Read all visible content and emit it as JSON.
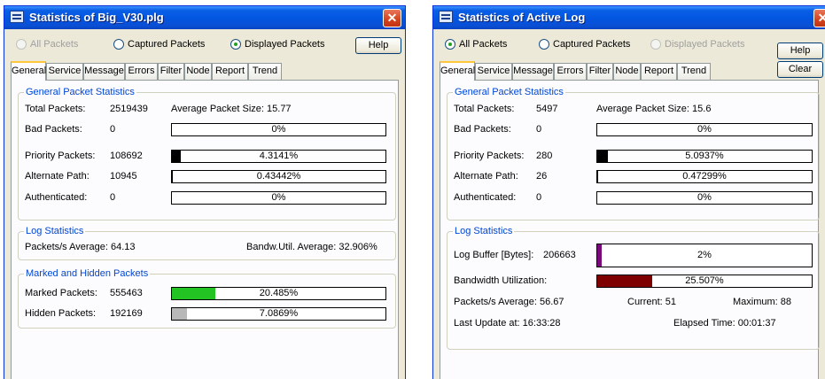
{
  "left_window": {
    "title": "Statistics of Big_V30.plg",
    "radios": [
      {
        "label": "All Packets",
        "checked": false,
        "disabled": true
      },
      {
        "label": "Captured Packets",
        "checked": false,
        "disabled": false
      },
      {
        "label": "Displayed Packets",
        "checked": true,
        "disabled": false
      }
    ],
    "help_label": "Help",
    "tabs": [
      "General",
      "Service",
      "Message",
      "Errors",
      "Filter",
      "Node",
      "Report",
      "Trend"
    ],
    "active_tab": "General",
    "general": {
      "title": "General Packet Statistics",
      "total_label": "Total Packets:",
      "total_value": "2519439",
      "avg_size": "Average Packet Size:  15.77",
      "bad_label": "Bad Packets:",
      "bad_value": "0",
      "bad_pct": "0%",
      "bad_frac": 0,
      "priority_label": "Priority Packets:",
      "priority_value": "108692",
      "priority_pct": "4.3141%",
      "priority_frac": 0.043,
      "alternate_label": "Alternate Path:",
      "alternate_value": "10945",
      "alternate_pct": "0.43442%",
      "alternate_frac": 0.004,
      "auth_label": "Authenticated:",
      "auth_value": "0",
      "auth_pct": "0%",
      "auth_frac": 0
    },
    "log": {
      "title": "Log Statistics",
      "pps": "Packets/s Average:  64.13",
      "bandw": "Bandw.Util. Average:   32.906%"
    },
    "marked": {
      "title": "Marked and Hidden Packets",
      "marked_label": "Marked Packets:",
      "marked_value": "555463",
      "marked_pct": "20.485%",
      "marked_frac": 0.205,
      "hidden_label": "Hidden Packets:",
      "hidden_value": "192169",
      "hidden_pct": "7.0869%",
      "hidden_frac": 0.071
    }
  },
  "right_window": {
    "title": "Statistics of Active Log",
    "radios": [
      {
        "label": "All Packets",
        "checked": true,
        "disabled": false
      },
      {
        "label": "Captured Packets",
        "checked": false,
        "disabled": false
      },
      {
        "label": "Displayed Packets",
        "checked": false,
        "disabled": true
      }
    ],
    "help_label": "Help",
    "clear_label": "Clear",
    "tabs": [
      "General",
      "Service",
      "Message",
      "Errors",
      "Filter",
      "Node",
      "Report",
      "Trend"
    ],
    "active_tab": "General",
    "general": {
      "title": "General Packet Statistics",
      "total_label": "Total Packets:",
      "total_value": "5497",
      "avg_size": "Average Packet Size:  15.6",
      "bad_label": "Bad Packets:",
      "bad_value": "0",
      "bad_pct": "0%",
      "bad_frac": 0,
      "priority_label": "Priority Packets:",
      "priority_value": "280",
      "priority_pct": "5.0937%",
      "priority_frac": 0.051,
      "alternate_label": "Alternate Path:",
      "alternate_value": "26",
      "alternate_pct": "0.47299%",
      "alternate_frac": 0.005,
      "auth_label": "Authenticated:",
      "auth_value": "0",
      "auth_pct": "0%",
      "auth_frac": 0
    },
    "log": {
      "title": "Log Statistics",
      "buffer_label": "Log Buffer [Bytes]:",
      "buffer_value": "206663",
      "buffer_pct": "2%",
      "buffer_frac": 0.02,
      "bandwidth_label": "Bandwidth Utilization:",
      "bandwidth_pct": "25.507%",
      "bandwidth_frac": 0.255,
      "pps": "Packets/s Average: 56.67",
      "current": "Current: 51",
      "maximum": "Maximum: 88",
      "last_update": "Last Update at:    16:33:28",
      "elapsed": "Elapsed Time:      00:01:37"
    }
  },
  "colors": {
    "priority_fill": "#000000",
    "marked_fill": "#22c322",
    "hidden_fill": "#b8b8b8",
    "buffer_fill": "#7a0a7a",
    "bandwidth_fill": "#7f0000",
    "group_title": "#0046d5",
    "title_bar": "#0355e0"
  },
  "icons": {
    "window_icon": "app-window-icon",
    "close": "close-icon"
  }
}
